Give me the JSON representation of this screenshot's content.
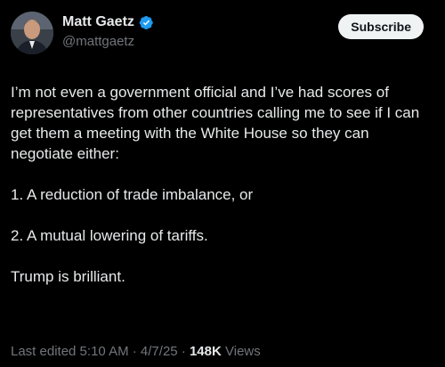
{
  "post": {
    "author": {
      "display_name": "Matt Gaetz",
      "handle": "@mattgaetz",
      "verified": true
    },
    "subscribe_label": "Subscribe",
    "paragraphs": [
      "I’m not even a government official and I’ve had scores of representatives from other countries calling me to see if I can get them a meeting with the White House so they can negotiate either:",
      "1. A reduction of trade imbalance, or",
      "2. A mutual lowering of tariffs.",
      "Trump is brilliant."
    ],
    "meta": {
      "edited_label": "Last edited 5:10 AM · 4/7/25",
      "separator": "·",
      "views_count": "148K",
      "views_label": "Views"
    }
  },
  "colors": {
    "background": "#000000",
    "text_primary": "#e7e9ea",
    "text_secondary": "#71767b",
    "verified_badge": "#1d9bf0",
    "subscribe_bg": "#eff3f4"
  },
  "icons": [
    "avatar-photo",
    "verified-badge-icon"
  ]
}
